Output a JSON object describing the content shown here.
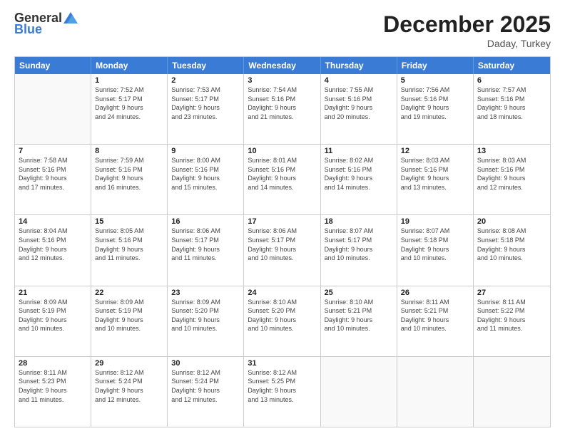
{
  "header": {
    "logo_general": "General",
    "logo_blue": "Blue",
    "month_title": "December 2025",
    "location": "Daday, Turkey"
  },
  "weekdays": [
    "Sunday",
    "Monday",
    "Tuesday",
    "Wednesday",
    "Thursday",
    "Friday",
    "Saturday"
  ],
  "rows": [
    [
      {
        "day": "",
        "info": ""
      },
      {
        "day": "1",
        "info": "Sunrise: 7:52 AM\nSunset: 5:17 PM\nDaylight: 9 hours\nand 24 minutes."
      },
      {
        "day": "2",
        "info": "Sunrise: 7:53 AM\nSunset: 5:17 PM\nDaylight: 9 hours\nand 23 minutes."
      },
      {
        "day": "3",
        "info": "Sunrise: 7:54 AM\nSunset: 5:16 PM\nDaylight: 9 hours\nand 21 minutes."
      },
      {
        "day": "4",
        "info": "Sunrise: 7:55 AM\nSunset: 5:16 PM\nDaylight: 9 hours\nand 20 minutes."
      },
      {
        "day": "5",
        "info": "Sunrise: 7:56 AM\nSunset: 5:16 PM\nDaylight: 9 hours\nand 19 minutes."
      },
      {
        "day": "6",
        "info": "Sunrise: 7:57 AM\nSunset: 5:16 PM\nDaylight: 9 hours\nand 18 minutes."
      }
    ],
    [
      {
        "day": "7",
        "info": "Sunrise: 7:58 AM\nSunset: 5:16 PM\nDaylight: 9 hours\nand 17 minutes."
      },
      {
        "day": "8",
        "info": "Sunrise: 7:59 AM\nSunset: 5:16 PM\nDaylight: 9 hours\nand 16 minutes."
      },
      {
        "day": "9",
        "info": "Sunrise: 8:00 AM\nSunset: 5:16 PM\nDaylight: 9 hours\nand 15 minutes."
      },
      {
        "day": "10",
        "info": "Sunrise: 8:01 AM\nSunset: 5:16 PM\nDaylight: 9 hours\nand 14 minutes."
      },
      {
        "day": "11",
        "info": "Sunrise: 8:02 AM\nSunset: 5:16 PM\nDaylight: 9 hours\nand 14 minutes."
      },
      {
        "day": "12",
        "info": "Sunrise: 8:03 AM\nSunset: 5:16 PM\nDaylight: 9 hours\nand 13 minutes."
      },
      {
        "day": "13",
        "info": "Sunrise: 8:03 AM\nSunset: 5:16 PM\nDaylight: 9 hours\nand 12 minutes."
      }
    ],
    [
      {
        "day": "14",
        "info": "Sunrise: 8:04 AM\nSunset: 5:16 PM\nDaylight: 9 hours\nand 12 minutes."
      },
      {
        "day": "15",
        "info": "Sunrise: 8:05 AM\nSunset: 5:16 PM\nDaylight: 9 hours\nand 11 minutes."
      },
      {
        "day": "16",
        "info": "Sunrise: 8:06 AM\nSunset: 5:17 PM\nDaylight: 9 hours\nand 11 minutes."
      },
      {
        "day": "17",
        "info": "Sunrise: 8:06 AM\nSunset: 5:17 PM\nDaylight: 9 hours\nand 10 minutes."
      },
      {
        "day": "18",
        "info": "Sunrise: 8:07 AM\nSunset: 5:17 PM\nDaylight: 9 hours\nand 10 minutes."
      },
      {
        "day": "19",
        "info": "Sunrise: 8:07 AM\nSunset: 5:18 PM\nDaylight: 9 hours\nand 10 minutes."
      },
      {
        "day": "20",
        "info": "Sunrise: 8:08 AM\nSunset: 5:18 PM\nDaylight: 9 hours\nand 10 minutes."
      }
    ],
    [
      {
        "day": "21",
        "info": "Sunrise: 8:09 AM\nSunset: 5:19 PM\nDaylight: 9 hours\nand 10 minutes."
      },
      {
        "day": "22",
        "info": "Sunrise: 8:09 AM\nSunset: 5:19 PM\nDaylight: 9 hours\nand 10 minutes."
      },
      {
        "day": "23",
        "info": "Sunrise: 8:09 AM\nSunset: 5:20 PM\nDaylight: 9 hours\nand 10 minutes."
      },
      {
        "day": "24",
        "info": "Sunrise: 8:10 AM\nSunset: 5:20 PM\nDaylight: 9 hours\nand 10 minutes."
      },
      {
        "day": "25",
        "info": "Sunrise: 8:10 AM\nSunset: 5:21 PM\nDaylight: 9 hours\nand 10 minutes."
      },
      {
        "day": "26",
        "info": "Sunrise: 8:11 AM\nSunset: 5:21 PM\nDaylight: 9 hours\nand 10 minutes."
      },
      {
        "day": "27",
        "info": "Sunrise: 8:11 AM\nSunset: 5:22 PM\nDaylight: 9 hours\nand 11 minutes."
      }
    ],
    [
      {
        "day": "28",
        "info": "Sunrise: 8:11 AM\nSunset: 5:23 PM\nDaylight: 9 hours\nand 11 minutes."
      },
      {
        "day": "29",
        "info": "Sunrise: 8:12 AM\nSunset: 5:24 PM\nDaylight: 9 hours\nand 12 minutes."
      },
      {
        "day": "30",
        "info": "Sunrise: 8:12 AM\nSunset: 5:24 PM\nDaylight: 9 hours\nand 12 minutes."
      },
      {
        "day": "31",
        "info": "Sunrise: 8:12 AM\nSunset: 5:25 PM\nDaylight: 9 hours\nand 13 minutes."
      },
      {
        "day": "",
        "info": ""
      },
      {
        "day": "",
        "info": ""
      },
      {
        "day": "",
        "info": ""
      }
    ]
  ]
}
